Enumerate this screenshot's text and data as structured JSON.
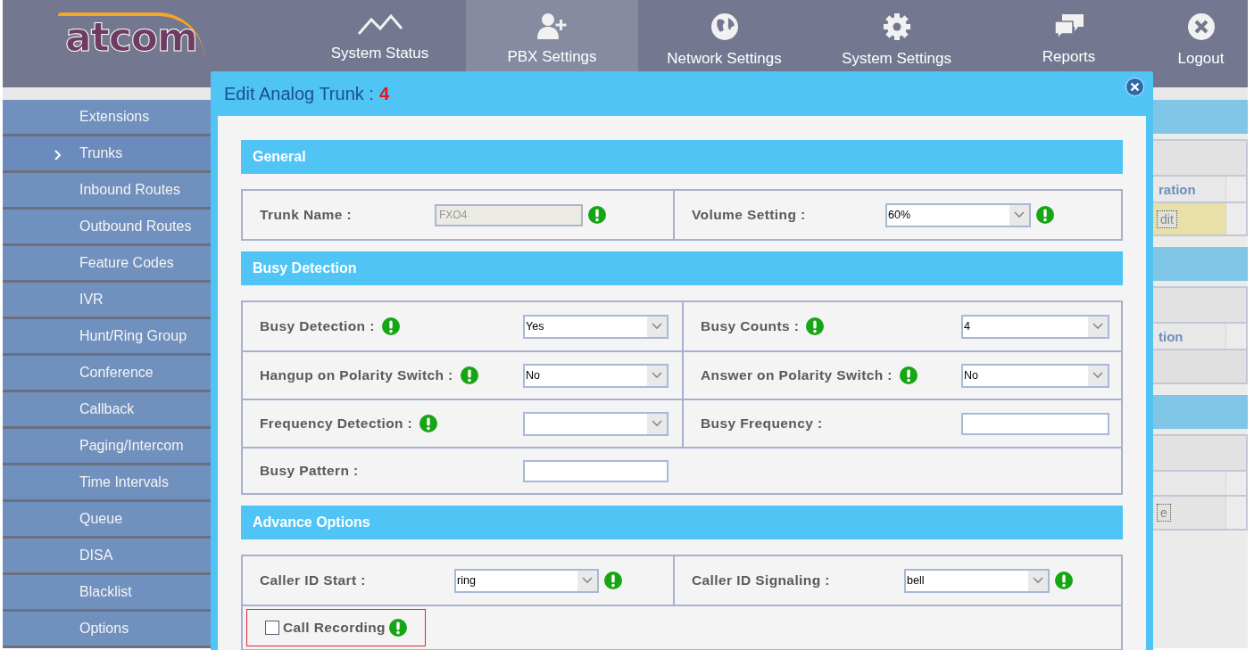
{
  "logo": "atcom",
  "nav": [
    {
      "label": "System Status",
      "selected": false
    },
    {
      "label": "PBX Settings",
      "selected": true
    },
    {
      "label": "Network Settings",
      "selected": false
    },
    {
      "label": "System Settings",
      "selected": false
    },
    {
      "label": "Reports",
      "selected": false
    },
    {
      "label": "Logout",
      "selected": false
    }
  ],
  "sidebar": [
    {
      "label": "Extensions",
      "selected": false
    },
    {
      "label": "Trunks",
      "selected": true
    },
    {
      "label": "Inbound Routes",
      "selected": false
    },
    {
      "label": "Outbound Routes",
      "selected": false
    },
    {
      "label": "Feature Codes",
      "selected": false
    },
    {
      "label": "IVR",
      "selected": false
    },
    {
      "label": "Hunt/Ring Group",
      "selected": false
    },
    {
      "label": "Conference",
      "selected": false
    },
    {
      "label": "Callback",
      "selected": false
    },
    {
      "label": "Paging/Intercom",
      "selected": false
    },
    {
      "label": "Time Intervals",
      "selected": false
    },
    {
      "label": "Queue",
      "selected": false
    },
    {
      "label": "DISA",
      "selected": false
    },
    {
      "label": "Blacklist",
      "selected": false
    },
    {
      "label": "Options",
      "selected": false
    }
  ],
  "background_panels": [
    {
      "column_text": "ration",
      "button": "dit"
    },
    {
      "column_text": "tion"
    },
    {
      "button": "e"
    }
  ],
  "dialog": {
    "title": "Edit Analog Trunk :",
    "trunk_number": "4",
    "sections": [
      {
        "title": "General",
        "rows": [
          [
            {
              "kind": "text",
              "label": "Trunk Name :",
              "value": "FXO4",
              "disabled": true,
              "help": true
            },
            {
              "kind": "select",
              "label": "Volume Setting :",
              "value": "60%",
              "help": true
            }
          ]
        ]
      },
      {
        "title": "Busy Detection",
        "rows": [
          [
            {
              "kind": "select",
              "label": "Busy Detection :",
              "value": "Yes",
              "help": true
            },
            {
              "kind": "select",
              "label": "Busy Counts :",
              "value": "4",
              "help": true
            }
          ],
          [
            {
              "kind": "select",
              "label": "Hangup on Polarity Switch :",
              "value": "No",
              "help": true
            },
            {
              "kind": "select",
              "label": "Answer on Polarity Switch :",
              "value": "No",
              "help": true
            }
          ],
          [
            {
              "kind": "select",
              "label": "Frequency Detection :",
              "help": true
            },
            {
              "kind": "text",
              "label": "Busy Frequency :",
              "disabled": false,
              "help": false
            }
          ],
          [
            {
              "kind": "text",
              "label": "Busy Pattern :",
              "disabled": false,
              "help": false
            }
          ]
        ]
      },
      {
        "title": "Advance Options",
        "rows": [
          [
            {
              "kind": "select",
              "label": "Caller ID Start :",
              "value": "ring",
              "help": true
            },
            {
              "kind": "select",
              "label": "Caller ID Signaling :",
              "value": "bell",
              "help": true
            }
          ],
          [
            {
              "kind": "checkbox",
              "label": "Call Recording",
              "checked": false,
              "highlighted": true,
              "help": true
            }
          ]
        ]
      }
    ]
  }
}
